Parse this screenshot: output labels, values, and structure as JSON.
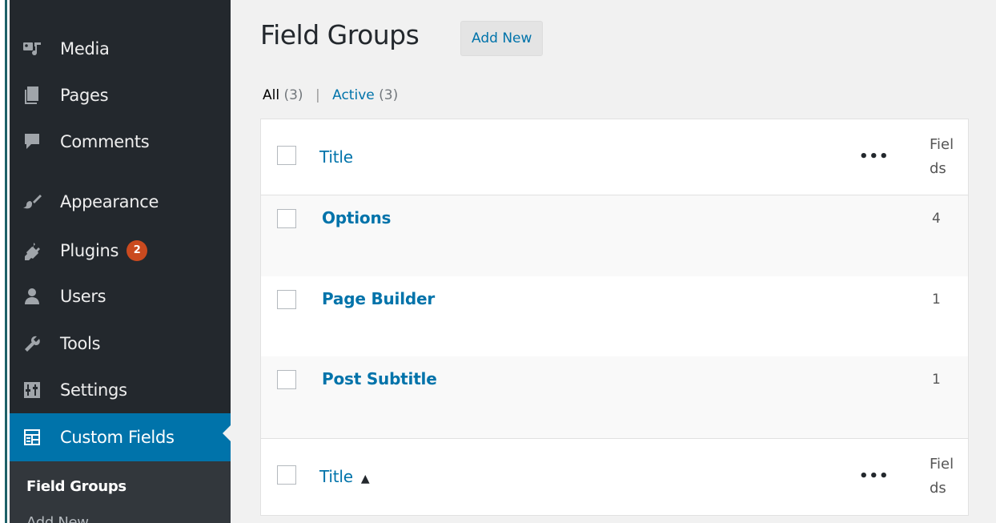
{
  "sidebar": {
    "items": [
      {
        "label": "Media",
        "icon": "media-icon"
      },
      {
        "label": "Pages",
        "icon": "pages-icon"
      },
      {
        "label": "Comments",
        "icon": "comments-icon"
      },
      {
        "label": "Appearance",
        "icon": "appearance-icon"
      },
      {
        "label": "Plugins",
        "icon": "plugins-icon",
        "badge": "2"
      },
      {
        "label": "Users",
        "icon": "users-icon"
      },
      {
        "label": "Tools",
        "icon": "tools-icon"
      },
      {
        "label": "Settings",
        "icon": "settings-icon"
      },
      {
        "label": "Custom Fields",
        "icon": "custom-fields-icon",
        "active": true
      }
    ],
    "submenu": [
      {
        "label": "Field Groups",
        "current": true
      },
      {
        "label": "Add New"
      }
    ]
  },
  "page": {
    "title": "Field Groups",
    "add_new_label": "Add New"
  },
  "filters": {
    "all_label": "All",
    "all_count": "(3)",
    "separator": "|",
    "active_label": "Active",
    "active_count": "(3)"
  },
  "table": {
    "header": {
      "title": "Title",
      "more": "•••",
      "fields": "Fields"
    },
    "footer": {
      "title": "Title",
      "sort_indicator": "▲",
      "more": "•••",
      "fields": "Fields"
    },
    "rows": [
      {
        "title": "Options",
        "fields": "4"
      },
      {
        "title": "Page Builder",
        "fields": "1"
      },
      {
        "title": "Post Subtitle",
        "fields": "1"
      }
    ]
  },
  "colors": {
    "sidebar_bg": "#23282d",
    "active_bg": "#0073aa",
    "link": "#0073aa",
    "badge": "#ca4a1f"
  }
}
